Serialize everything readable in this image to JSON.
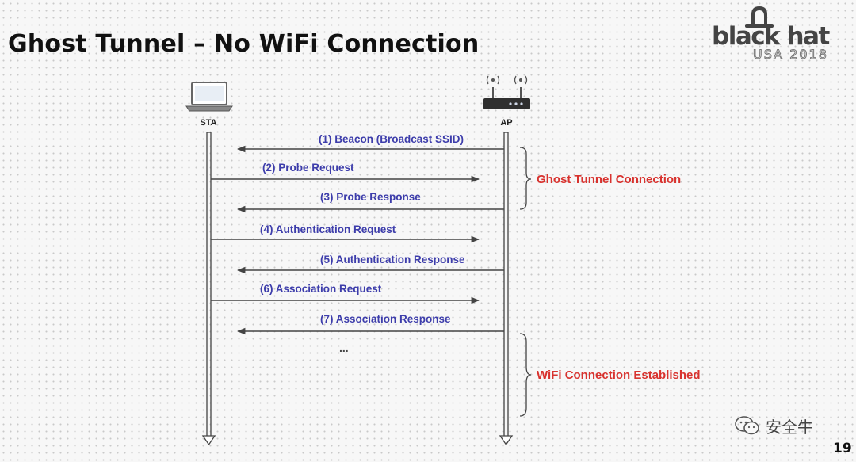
{
  "slide": {
    "title": "Ghost Tunnel – No WiFi Connection",
    "page_number": "19"
  },
  "logo": {
    "brand": "black hat",
    "event": "USA 2018"
  },
  "watermark": {
    "text": "安全牛",
    "icon": "wechat-icon"
  },
  "diagram": {
    "actors": {
      "sta": "STA",
      "ap": "AP"
    },
    "messages": [
      {
        "label": "(1) Beacon (Broadcast SSID)",
        "direction": "ap-to-sta"
      },
      {
        "label": "(2) Probe Request",
        "direction": "sta-to-ap"
      },
      {
        "label": "(3) Probe Response",
        "direction": "ap-to-sta"
      },
      {
        "label": "(4) Authentication Request",
        "direction": "sta-to-ap"
      },
      {
        "label": "(5) Authentication Response",
        "direction": "ap-to-sta"
      },
      {
        "label": "(6) Association Request",
        "direction": "sta-to-ap"
      },
      {
        "label": "(7) Association Response",
        "direction": "ap-to-sta"
      }
    ],
    "ellipsis": "...",
    "groups": [
      {
        "label": "Ghost Tunnel Connection"
      },
      {
        "label": "WiFi Connection Established"
      }
    ],
    "colors": {
      "message_text": "#3d3dab",
      "group_text": "#d8322e",
      "lines": "#444444"
    }
  }
}
